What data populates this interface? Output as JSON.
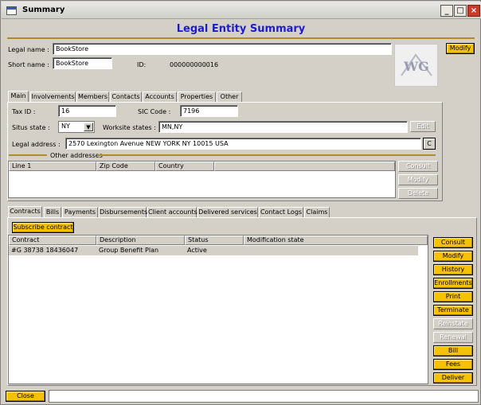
{
  "window": {
    "title": "Summary",
    "min_label": "_",
    "max_label": "□",
    "close_label": "×"
  },
  "header": {
    "title": "Legal Entity Summary"
  },
  "entity": {
    "legal_name_label": "Legal name :",
    "legal_name": "BookStore",
    "short_name_label": "Short name :",
    "short_name": "BookStore",
    "id_label": "ID:",
    "id_value": "000000000016",
    "modify_label": "Modify",
    "logo_text": "WG"
  },
  "top_tabs": [
    {
      "label": "Main"
    },
    {
      "label": "Involvements"
    },
    {
      "label": "Members"
    },
    {
      "label": "Contacts"
    },
    {
      "label": "Accounts"
    },
    {
      "label": "Properties"
    },
    {
      "label": "Other"
    }
  ],
  "main": {
    "tax_id_label": "Tax ID :",
    "tax_id": "16",
    "sic_label": "SIC Code :",
    "sic": "7196",
    "situs_label": "Situs state :",
    "situs": "NY",
    "worksite_label": "Worksite states :",
    "worksite": "MN,NY",
    "edit_label": "Edit",
    "legal_address_label": "Legal address :",
    "legal_address": "2570 Lexington Avenue  NEW YORK NY 10015 USA",
    "c_label": "C",
    "other_addresses_label": "Other addresses",
    "addr_columns": [
      "Line 1",
      "Zip Code",
      "Country"
    ],
    "addr_buttons": [
      "Consult",
      "Modify",
      "Delete"
    ]
  },
  "bottom_tabs": [
    {
      "label": "Contracts"
    },
    {
      "label": "Bills"
    },
    {
      "label": "Payments"
    },
    {
      "label": "Disbursements"
    },
    {
      "label": "Client accounts"
    },
    {
      "label": "Delivered services"
    },
    {
      "label": "Contact Logs"
    },
    {
      "label": "Claims"
    }
  ],
  "contracts": {
    "subscribe_label": "Subscribe contract",
    "columns": [
      "Contract",
      "Description",
      "Status",
      "Modification state"
    ],
    "rows": [
      {
        "contract": "#G 38738 18436047",
        "description": "Group Benefit Plan",
        "status": "Active",
        "modification": ""
      }
    ],
    "actions": [
      {
        "label": "Consult",
        "enabled": true
      },
      {
        "label": "Modify",
        "enabled": true
      },
      {
        "label": "History",
        "enabled": true
      },
      {
        "label": "Enrollments",
        "enabled": true
      },
      {
        "label": "Print",
        "enabled": true
      },
      {
        "label": "Terminate",
        "enabled": true
      },
      {
        "label": "Reinstate",
        "enabled": false
      },
      {
        "label": "Renewal",
        "enabled": false
      },
      {
        "label": "Bill",
        "enabled": true
      },
      {
        "label": "Fees",
        "enabled": true
      },
      {
        "label": "Deliver",
        "enabled": true
      }
    ]
  },
  "footer": {
    "close_label": "Close"
  },
  "colors": {
    "accent_button": "#f4c200",
    "title_text": "#1c1cd0",
    "gold_rule": "#b08c2a"
  }
}
